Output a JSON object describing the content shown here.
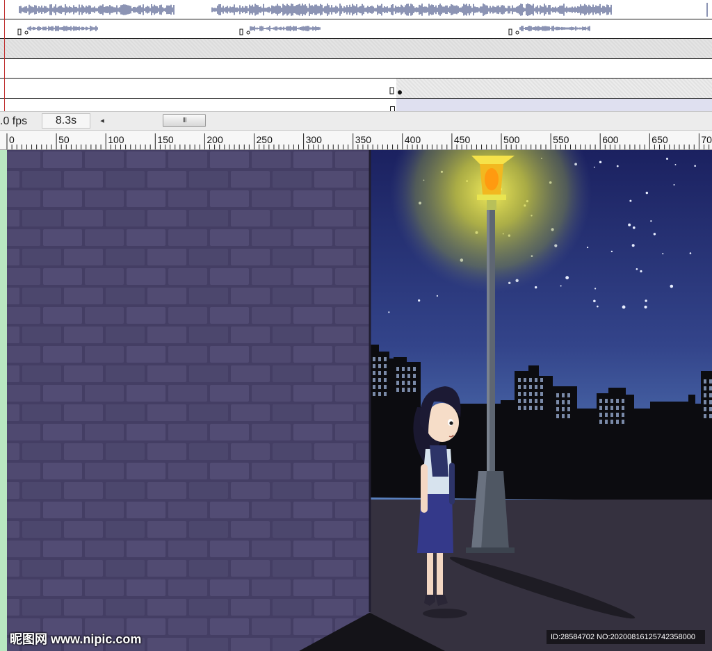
{
  "timeline": {
    "fps_label": ".0 fps",
    "time_label": "8.3s",
    "scroll_left_glyph": "◂",
    "scroll_thumb_grip": "III"
  },
  "ruler": {
    "ticks": [
      "0",
      "50",
      "100",
      "150",
      "200",
      "250",
      "300",
      "350",
      "400",
      "450",
      "500",
      "550",
      "600",
      "650",
      "70"
    ]
  },
  "watermark": {
    "site": "昵图网 www.nipic.com",
    "id_text": "ID:28584702 NO:20200816125742358000"
  },
  "colors": {
    "sky_top": "#1b2160",
    "sky_bottom": "#4a6fb0",
    "wall": "#4d4670",
    "lamp_glow": "#f4f02a",
    "ground": "#35313f",
    "playhead": "#c03030"
  }
}
